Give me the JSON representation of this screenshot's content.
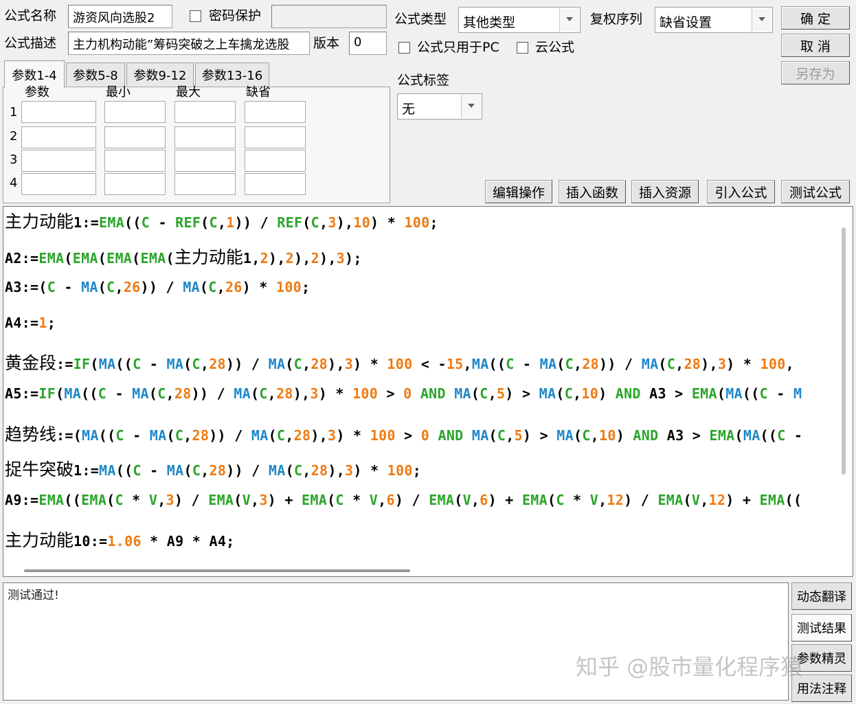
{
  "header": {
    "name_label": "公式名称",
    "name_value": "游资风向选股2",
    "password_label": "密码保护",
    "password_value": "",
    "desc_label": "公式描述",
    "desc_value": "主力机构动能”筹码突破之上车擒龙选股",
    "version_label": "版本",
    "version_value": "0"
  },
  "type_panel": {
    "type_label": "公式类型",
    "type_value": "其他类型",
    "rights_label": "复权序列",
    "rights_value": "缺省设置",
    "pc_only_label": "公式只用于PC",
    "cloud_label": "云公式",
    "tag_label": "公式标签",
    "tag_value": "无"
  },
  "buttons": {
    "ok": "确 定",
    "cancel": "取 消",
    "save_as": "另存为",
    "edit_ops": "编辑操作",
    "insert_func": "插入函数",
    "insert_res": "插入资源",
    "import_formula": "引入公式",
    "test_formula": "测试公式"
  },
  "params": {
    "tabs": [
      "参数1-4",
      "参数5-8",
      "参数9-12",
      "参数13-16"
    ],
    "columns": [
      "参数",
      "最小",
      "最大",
      "缺省"
    ],
    "rows": [
      "1",
      "2",
      "3",
      "4"
    ]
  },
  "code_lines": [
    [
      [
        "cj",
        "主力动能"
      ],
      [
        "k",
        "1:="
      ],
      [
        "g",
        "EMA"
      ],
      [
        "k",
        "(("
      ],
      [
        "g",
        "C"
      ],
      [
        "k",
        " - "
      ],
      [
        "g",
        "REF"
      ],
      [
        "k",
        "("
      ],
      [
        "g",
        "C"
      ],
      [
        "k",
        ","
      ],
      [
        "o",
        "1"
      ],
      [
        "k",
        ")) / "
      ],
      [
        "g",
        "REF"
      ],
      [
        "k",
        "("
      ],
      [
        "g",
        "C"
      ],
      [
        "k",
        ","
      ],
      [
        "o",
        "3"
      ],
      [
        "k",
        "),"
      ],
      [
        "o",
        "10"
      ],
      [
        "k",
        ") * "
      ],
      [
        "o",
        "100"
      ],
      [
        "k",
        ";"
      ]
    ],
    [
      [
        "k",
        "A2:="
      ],
      [
        "g",
        "EMA"
      ],
      [
        "k",
        "("
      ],
      [
        "g",
        "EMA"
      ],
      [
        "k",
        "("
      ],
      [
        "g",
        "EMA"
      ],
      [
        "k",
        "("
      ],
      [
        "g",
        "EMA"
      ],
      [
        "k",
        "("
      ],
      [
        "cj",
        "主力动能"
      ],
      [
        "k",
        "1,"
      ],
      [
        "o",
        "2"
      ],
      [
        "k",
        "),"
      ],
      [
        "o",
        "2"
      ],
      [
        "k",
        "),"
      ],
      [
        "o",
        "2"
      ],
      [
        "k",
        "),"
      ],
      [
        "o",
        "3"
      ],
      [
        "k",
        ");"
      ]
    ],
    [
      [
        "k",
        "A3:=("
      ],
      [
        "g",
        "C"
      ],
      [
        "k",
        " - "
      ],
      [
        "b",
        "MA"
      ],
      [
        "k",
        "("
      ],
      [
        "g",
        "C"
      ],
      [
        "k",
        ","
      ],
      [
        "o",
        "26"
      ],
      [
        "k",
        ")) / "
      ],
      [
        "b",
        "MA"
      ],
      [
        "k",
        "("
      ],
      [
        "g",
        "C"
      ],
      [
        "k",
        ","
      ],
      [
        "o",
        "26"
      ],
      [
        "k",
        ") * "
      ],
      [
        "o",
        "100"
      ],
      [
        "k",
        ";"
      ]
    ],
    [
      [
        "k",
        "A4:="
      ],
      [
        "o",
        "1"
      ],
      [
        "k",
        ";"
      ]
    ],
    [
      [
        "cj",
        "黄金段"
      ],
      [
        "k",
        ":="
      ],
      [
        "g",
        "IF"
      ],
      [
        "k",
        "("
      ],
      [
        "b",
        "MA"
      ],
      [
        "k",
        "(("
      ],
      [
        "g",
        "C"
      ],
      [
        "k",
        " - "
      ],
      [
        "b",
        "MA"
      ],
      [
        "k",
        "("
      ],
      [
        "g",
        "C"
      ],
      [
        "k",
        ","
      ],
      [
        "o",
        "28"
      ],
      [
        "k",
        ")) / "
      ],
      [
        "b",
        "MA"
      ],
      [
        "k",
        "("
      ],
      [
        "g",
        "C"
      ],
      [
        "k",
        ","
      ],
      [
        "o",
        "28"
      ],
      [
        "k",
        "),"
      ],
      [
        "o",
        "3"
      ],
      [
        "k",
        ") * "
      ],
      [
        "o",
        "100"
      ],
      [
        "k",
        " < -"
      ],
      [
        "o",
        "15"
      ],
      [
        "k",
        ","
      ],
      [
        "b",
        "MA"
      ],
      [
        "k",
        "(("
      ],
      [
        "g",
        "C"
      ],
      [
        "k",
        " - "
      ],
      [
        "b",
        "MA"
      ],
      [
        "k",
        "("
      ],
      [
        "g",
        "C"
      ],
      [
        "k",
        ","
      ],
      [
        "o",
        "28"
      ],
      [
        "k",
        ")) / "
      ],
      [
        "b",
        "MA"
      ],
      [
        "k",
        "("
      ],
      [
        "g",
        "C"
      ],
      [
        "k",
        ","
      ],
      [
        "o",
        "28"
      ],
      [
        "k",
        "),"
      ],
      [
        "o",
        "3"
      ],
      [
        "k",
        ") * "
      ],
      [
        "o",
        "100"
      ],
      [
        "k",
        ","
      ]
    ],
    [
      [
        "k",
        "A5:="
      ],
      [
        "g",
        "IF"
      ],
      [
        "k",
        "("
      ],
      [
        "b",
        "MA"
      ],
      [
        "k",
        "(("
      ],
      [
        "g",
        "C"
      ],
      [
        "k",
        " - "
      ],
      [
        "b",
        "MA"
      ],
      [
        "k",
        "("
      ],
      [
        "g",
        "C"
      ],
      [
        "k",
        ","
      ],
      [
        "o",
        "28"
      ],
      [
        "k",
        ")) / "
      ],
      [
        "b",
        "MA"
      ],
      [
        "k",
        "("
      ],
      [
        "g",
        "C"
      ],
      [
        "k",
        ","
      ],
      [
        "o",
        "28"
      ],
      [
        "k",
        "),"
      ],
      [
        "o",
        "3"
      ],
      [
        "k",
        ") * "
      ],
      [
        "o",
        "100"
      ],
      [
        "k",
        " > "
      ],
      [
        "o",
        "0"
      ],
      [
        "g",
        " AND "
      ],
      [
        "b",
        "MA"
      ],
      [
        "k",
        "("
      ],
      [
        "g",
        "C"
      ],
      [
        "k",
        ","
      ],
      [
        "o",
        "5"
      ],
      [
        "k",
        ") > "
      ],
      [
        "b",
        "MA"
      ],
      [
        "k",
        "("
      ],
      [
        "g",
        "C"
      ],
      [
        "k",
        ","
      ],
      [
        "o",
        "10"
      ],
      [
        "k",
        ")"
      ],
      [
        "g",
        " AND "
      ],
      [
        "k",
        "A3 > "
      ],
      [
        "g",
        "EMA"
      ],
      [
        "k",
        "("
      ],
      [
        "b",
        "MA"
      ],
      [
        "k",
        "(("
      ],
      [
        "g",
        "C"
      ],
      [
        "k",
        " - "
      ],
      [
        "b",
        "M"
      ]
    ],
    [
      [
        "cj",
        "趋势线"
      ],
      [
        "k",
        ":=("
      ],
      [
        "b",
        "MA"
      ],
      [
        "k",
        "(("
      ],
      [
        "g",
        "C"
      ],
      [
        "k",
        " - "
      ],
      [
        "b",
        "MA"
      ],
      [
        "k",
        "("
      ],
      [
        "g",
        "C"
      ],
      [
        "k",
        ","
      ],
      [
        "o",
        "28"
      ],
      [
        "k",
        ")) / "
      ],
      [
        "b",
        "MA"
      ],
      [
        "k",
        "("
      ],
      [
        "g",
        "C"
      ],
      [
        "k",
        ","
      ],
      [
        "o",
        "28"
      ],
      [
        "k",
        "),"
      ],
      [
        "o",
        "3"
      ],
      [
        "k",
        ") * "
      ],
      [
        "o",
        "100"
      ],
      [
        "k",
        " > "
      ],
      [
        "o",
        "0"
      ],
      [
        "g",
        " AND "
      ],
      [
        "b",
        "MA"
      ],
      [
        "k",
        "("
      ],
      [
        "g",
        "C"
      ],
      [
        "k",
        ","
      ],
      [
        "o",
        "5"
      ],
      [
        "k",
        ") > "
      ],
      [
        "b",
        "MA"
      ],
      [
        "k",
        "("
      ],
      [
        "g",
        "C"
      ],
      [
        "k",
        ","
      ],
      [
        "o",
        "10"
      ],
      [
        "k",
        ")"
      ],
      [
        "g",
        " AND "
      ],
      [
        "k",
        "A3 > "
      ],
      [
        "g",
        "EMA"
      ],
      [
        "k",
        "("
      ],
      [
        "b",
        "MA"
      ],
      [
        "k",
        "(("
      ],
      [
        "g",
        "C"
      ],
      [
        "k",
        " -"
      ]
    ],
    [
      [
        "cj",
        "捉牛突破"
      ],
      [
        "k",
        "1:="
      ],
      [
        "b",
        "MA"
      ],
      [
        "k",
        "(("
      ],
      [
        "g",
        "C"
      ],
      [
        "k",
        " - "
      ],
      [
        "b",
        "MA"
      ],
      [
        "k",
        "("
      ],
      [
        "g",
        "C"
      ],
      [
        "k",
        ","
      ],
      [
        "o",
        "28"
      ],
      [
        "k",
        ")) / "
      ],
      [
        "b",
        "MA"
      ],
      [
        "k",
        "("
      ],
      [
        "g",
        "C"
      ],
      [
        "k",
        ","
      ],
      [
        "o",
        "28"
      ],
      [
        "k",
        "),"
      ],
      [
        "o",
        "3"
      ],
      [
        "k",
        ") * "
      ],
      [
        "o",
        "100"
      ],
      [
        "k",
        ";"
      ]
    ],
    [
      [
        "k",
        "A9:="
      ],
      [
        "g",
        "EMA"
      ],
      [
        "k",
        "(("
      ],
      [
        "g",
        "EMA"
      ],
      [
        "k",
        "("
      ],
      [
        "g",
        "C"
      ],
      [
        "k",
        " * "
      ],
      [
        "g",
        "V"
      ],
      [
        "k",
        ","
      ],
      [
        "o",
        "3"
      ],
      [
        "k",
        ") / "
      ],
      [
        "g",
        "EMA"
      ],
      [
        "k",
        "("
      ],
      [
        "g",
        "V"
      ],
      [
        "k",
        ","
      ],
      [
        "o",
        "3"
      ],
      [
        "k",
        ") + "
      ],
      [
        "g",
        "EMA"
      ],
      [
        "k",
        "("
      ],
      [
        "g",
        "C"
      ],
      [
        "k",
        " * "
      ],
      [
        "g",
        "V"
      ],
      [
        "k",
        ","
      ],
      [
        "o",
        "6"
      ],
      [
        "k",
        ") / "
      ],
      [
        "g",
        "EMA"
      ],
      [
        "k",
        "("
      ],
      [
        "g",
        "V"
      ],
      [
        "k",
        ","
      ],
      [
        "o",
        "6"
      ],
      [
        "k",
        ") + "
      ],
      [
        "g",
        "EMA"
      ],
      [
        "k",
        "("
      ],
      [
        "g",
        "C"
      ],
      [
        "k",
        " * "
      ],
      [
        "g",
        "V"
      ],
      [
        "k",
        ","
      ],
      [
        "o",
        "12"
      ],
      [
        "k",
        ") / "
      ],
      [
        "g",
        "EMA"
      ],
      [
        "k",
        "("
      ],
      [
        "g",
        "V"
      ],
      [
        "k",
        ","
      ],
      [
        "o",
        "12"
      ],
      [
        "k",
        ") + "
      ],
      [
        "g",
        "EMA"
      ],
      [
        "k",
        "(("
      ]
    ],
    [
      [
        "cj",
        "主力动能"
      ],
      [
        "k",
        "10:="
      ],
      [
        "o",
        "1.06"
      ],
      [
        "k",
        " * A9 * A4;"
      ]
    ]
  ],
  "output_text": "测试通过!",
  "side_buttons": [
    "动态翻译",
    "测试结果",
    "参数精灵",
    "用法注释"
  ],
  "watermark": "知乎 @股市量化程序猿",
  "colors": {
    "keyword_green": "#2aa52a",
    "func_blue": "#1e88c8",
    "number_orange": "#ee7a10"
  }
}
